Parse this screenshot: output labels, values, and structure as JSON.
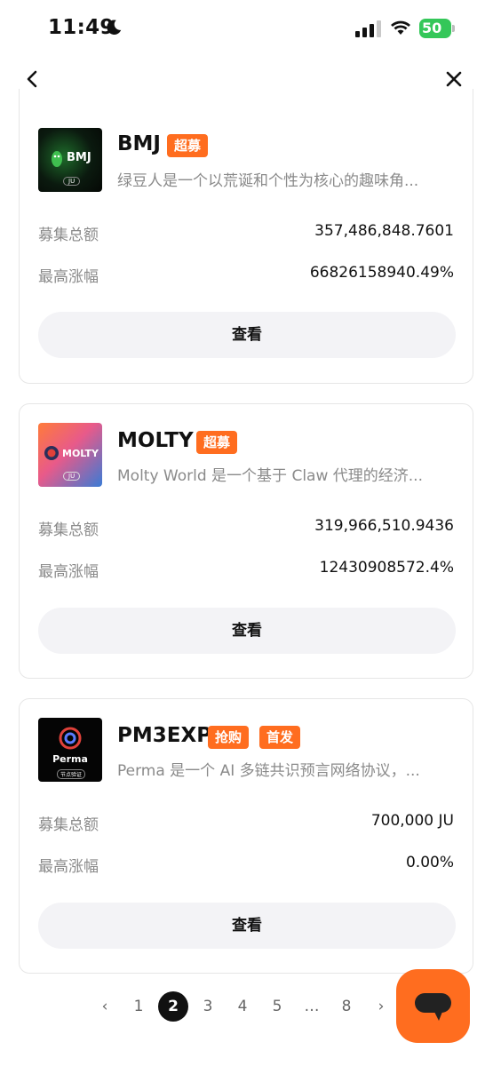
{
  "status_bar": {
    "time": "11:49",
    "battery": "50"
  },
  "cards": [
    {
      "logo_text": "BMJ",
      "logo_sub": "JU",
      "name": "BMJ",
      "badges": [
        "超募"
      ],
      "description": "绿豆人是一个以荒诞和个性为核心的趣味角...",
      "raised_label": "募集总额",
      "raised_value": "357,486,848.7601",
      "max_gain_label": "最高涨幅",
      "max_gain_value": "66826158940.49%",
      "button_label": "查看"
    },
    {
      "logo_text": "MOLTY",
      "logo_sub": "JU",
      "name": "MOLTY",
      "badges": [
        "超募"
      ],
      "description": "Molty World 是一个基于 Claw 代理的经济...",
      "raised_label": "募集总额",
      "raised_value": "319,966,510.9436",
      "max_gain_label": "最高涨幅",
      "max_gain_value": "12430908572.4%",
      "button_label": "查看"
    },
    {
      "logo_text": "Perma",
      "logo_sub": "节点验证",
      "name": "PM3EXP",
      "badges": [
        "抢购",
        "首发"
      ],
      "description": "Perma 是一个 AI 多链共识预言网络协议，...",
      "raised_label": "募集总额",
      "raised_value": "700,000 JU",
      "max_gain_label": "最高涨幅",
      "max_gain_value": "0.00%",
      "button_label": "查看"
    }
  ],
  "pagination": {
    "prev": "‹",
    "pages": [
      "1",
      "2",
      "3",
      "4",
      "5",
      "…",
      "8"
    ],
    "active": "2",
    "next": "›"
  },
  "colors": {
    "accent": "#ff6d1f",
    "button_bg": "#f3f3f6",
    "muted_text": "#8a8a8a"
  },
  "icons": [
    "back-icon",
    "close-icon",
    "chat-icon",
    "moon-icon",
    "signal-icon",
    "wifi-icon"
  ]
}
